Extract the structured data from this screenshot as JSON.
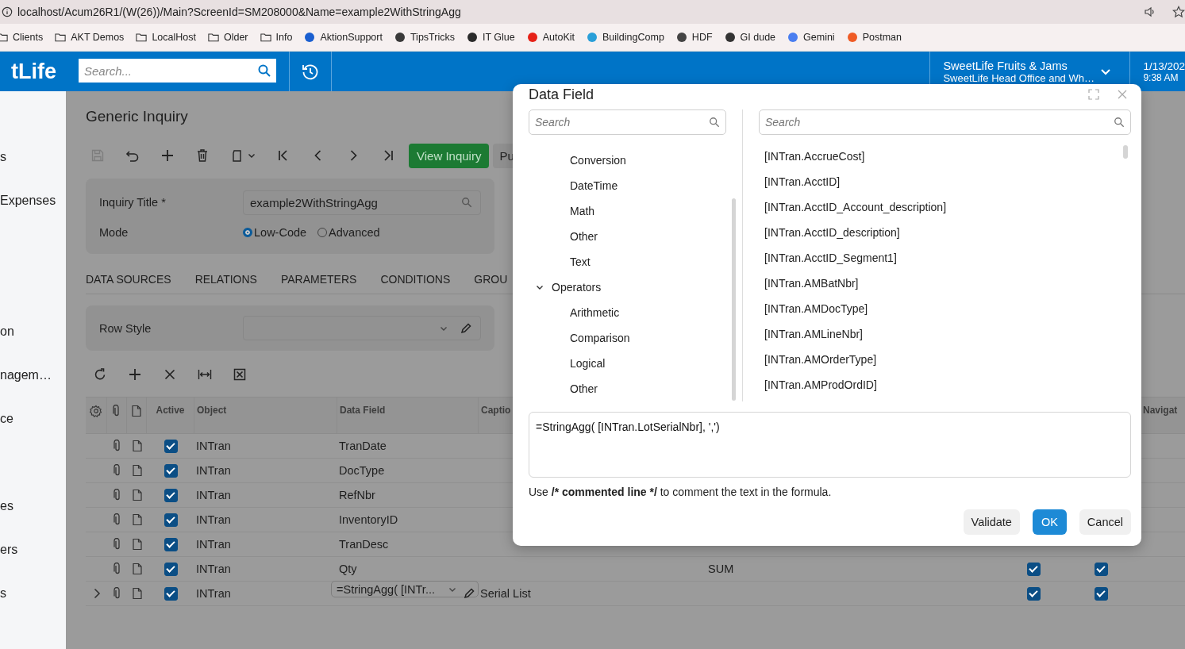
{
  "browser": {
    "url": "localhost/Acum26R1/(W(26))/Main?ScreenId=SM208000&Name=example2WithStringAgg"
  },
  "bookmarks": [
    {
      "label": "Clients",
      "kind": "folder"
    },
    {
      "label": "AKT Demos",
      "kind": "folder"
    },
    {
      "label": "LocalHost",
      "kind": "folder"
    },
    {
      "label": "Older",
      "kind": "folder"
    },
    {
      "label": "Info",
      "kind": "folder"
    },
    {
      "label": "AktionSupport",
      "kind": "site",
      "color": "#1a5fd0"
    },
    {
      "label": "TipsTricks",
      "kind": "site",
      "color": "#3a3a3a"
    },
    {
      "label": "IT Glue",
      "kind": "site",
      "color": "#2b2b2b"
    },
    {
      "label": "AutoKit",
      "kind": "site",
      "color": "#e62117"
    },
    {
      "label": "BuildingComp",
      "kind": "site",
      "color": "#2a9fd8"
    },
    {
      "label": "HDF",
      "kind": "site",
      "color": "#444444"
    },
    {
      "label": "GI dude",
      "kind": "site",
      "color": "#333333"
    },
    {
      "label": "Gemini",
      "kind": "site",
      "color": "#4a7ef0"
    },
    {
      "label": "Postman",
      "kind": "site",
      "color": "#ef5b25"
    }
  ],
  "header": {
    "logo": "tLife",
    "search": {
      "placeholder": "Search..."
    },
    "company": "SweetLife Fruits & Jams",
    "branch": "SweetLife Head Office and Wh…",
    "date": "1/13/202",
    "time": "9:38 AM"
  },
  "sidebar": {
    "items": [
      "s",
      "Expenses",
      "on",
      "nagem…",
      "ce",
      "es",
      "ers",
      "s"
    ]
  },
  "page": {
    "title": "Generic Inquiry",
    "toolbar": {
      "primary_button": "View Inquiry",
      "button_2": "Pu"
    },
    "form": {
      "title_label": "Inquiry Title *",
      "title_value": "example2WithStringAgg",
      "mode_label": "Mode",
      "modes": [
        {
          "label": "Low-Code",
          "selected": true
        },
        {
          "label": "Advanced",
          "selected": false
        }
      ]
    },
    "tabs": [
      {
        "label": "DATA SOURCES"
      },
      {
        "label": "RELATIONS"
      },
      {
        "label": "PARAMETERS"
      },
      {
        "label": "CONDITIONS"
      },
      {
        "label": "GROU"
      }
    ],
    "row_style": {
      "label": "Row Style"
    },
    "grid": {
      "columns": [
        "Active",
        "Object",
        "Data Field",
        "Captio",
        "Navigat"
      ],
      "rows": [
        {
          "expandable": false,
          "active": true,
          "object": "INTran",
          "data_field": "TranDate",
          "editing": false
        },
        {
          "expandable": false,
          "active": true,
          "object": "INTran",
          "data_field": "DocType",
          "editing": false
        },
        {
          "expandable": false,
          "active": true,
          "object": "INTran",
          "data_field": "RefNbr",
          "editing": false
        },
        {
          "expandable": false,
          "active": true,
          "object": "INTran",
          "data_field": "InventoryID",
          "editing": false
        },
        {
          "expandable": false,
          "active": true,
          "object": "INTran",
          "data_field": "TranDesc",
          "editing": false
        },
        {
          "expandable": false,
          "active": true,
          "object": "INTran",
          "data_field": "Qty",
          "editing": false,
          "aggregate": "SUM",
          "column_9": true,
          "column_10": true
        },
        {
          "expandable": true,
          "active": true,
          "object": "INTran",
          "data_field": "=StringAgg( [INTr...",
          "editing": true,
          "caption": "Serial List",
          "column_9": true,
          "column_10": true
        }
      ]
    }
  },
  "dialog": {
    "title": "Data Field",
    "left_search": {
      "placeholder": "Search"
    },
    "tree": [
      {
        "children": [
          {
            "label": "Conversion"
          },
          {
            "label": "DateTime"
          },
          {
            "label": "Math"
          },
          {
            "label": "Other"
          },
          {
            "label": "Text"
          }
        ]
      },
      {
        "label": "Operators",
        "expanded": true,
        "children": [
          {
            "label": "Arithmetic"
          },
          {
            "label": "Comparison"
          },
          {
            "label": "Logical"
          },
          {
            "label": "Other"
          }
        ]
      }
    ],
    "right_search": {
      "placeholder": "Search"
    },
    "fields": [
      "[INTran.AccrueCost]",
      "[INTran.AcctID]",
      "[INTran.AcctID_Account_description]",
      "[INTran.AcctID_description]",
      "[INTran.AcctID_Segment1]",
      "[INTran.AMBatNbr]",
      "[INTran.AMDocType]",
      "[INTran.AMLineNbr]",
      "[INTran.AMOrderType]",
      "[INTran.AMProdOrdID]"
    ],
    "formula": "=StringAgg( [INTran.LotSerialNbr], ',')",
    "hint": [
      {
        "text": "Use ",
        "bold": false
      },
      {
        "text": "/* commented line */",
        "bold": true
      },
      {
        "text": " to comment the text in the formula.",
        "bold": false
      }
    ],
    "buttons": [
      {
        "label": "Validate",
        "kind": "default"
      },
      {
        "label": "OK",
        "kind": "primary"
      },
      {
        "label": "Cancel",
        "kind": "default"
      }
    ]
  }
}
